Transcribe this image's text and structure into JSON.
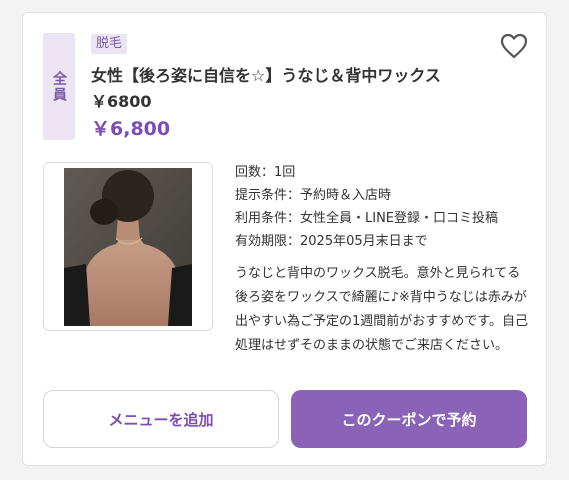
{
  "coupon": {
    "target_label": "全員",
    "category_tag": "脱毛",
    "title": "女性【後ろ姿に自信を☆】うなじ＆背中ワックス ￥6800",
    "price": "￥6,800",
    "favorite_icon": "heart-outline-icon",
    "info": [
      "回数：1回",
      "提示条件：予約時＆入店時",
      "利用条件：女性全員・LINE登録・口コミ投稿",
      "有効期限：2025年05月末日まで"
    ],
    "description": "うなじと背中のワックス脱毛。意外と見られてる後ろ姿をワックスで綺麗に♪※背中うなじは赤みが出やすい為ご予定の1週間前がおすすめです。自己処理はせずそのままの状態でご来店ください。"
  },
  "actions": {
    "add_menu_label": "メニューを追加",
    "book_label": "このクーポンで予約"
  },
  "colors": {
    "accent": "#7a4eb5",
    "button_fill": "#8a62b8",
    "badge_bg": "#ece4f3"
  }
}
